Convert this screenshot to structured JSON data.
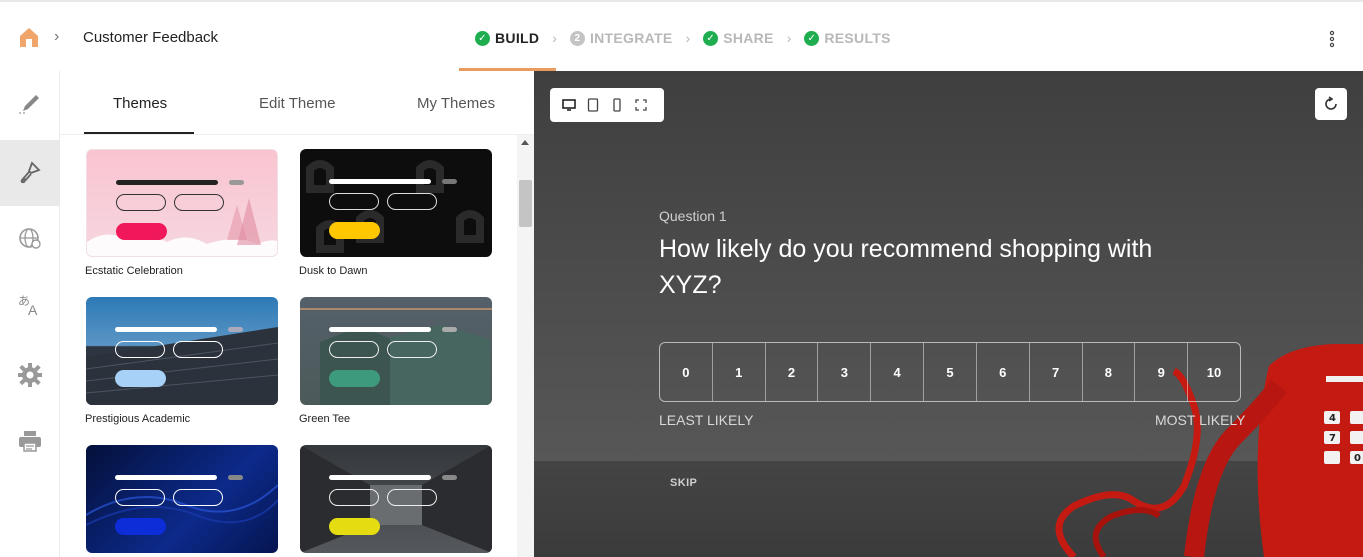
{
  "header": {
    "breadcrumb_title": "Customer Feedback",
    "steps": [
      {
        "label": "BUILD",
        "badge": "✓",
        "state": "done-active"
      },
      {
        "label": "INTEGRATE",
        "badge": "2",
        "state": "pending"
      },
      {
        "label": "SHARE",
        "badge": "✓",
        "state": "done"
      },
      {
        "label": "RESULTS",
        "badge": "✓",
        "state": "done"
      }
    ],
    "accent_color": "#e99b5d",
    "success_color": "#1fae4f"
  },
  "rail": {
    "items": [
      "edit-icon",
      "brush-icon",
      "globe-icon",
      "translate-icon",
      "gear-icon",
      "printer-icon"
    ],
    "active_index": 1
  },
  "panel": {
    "tabs": [
      {
        "label": "Themes",
        "active": true
      },
      {
        "label": "Edit Theme",
        "active": false
      },
      {
        "label": "My Themes",
        "active": false
      }
    ],
    "themes": [
      {
        "label": "Ecstatic Celebration",
        "cta_color": "#f0175a"
      },
      {
        "label": "Dusk to Dawn",
        "cta_color": "#ffc700"
      },
      {
        "label": "Prestigious Academic",
        "cta_color": "#a7d1f7"
      },
      {
        "label": "Green Tee",
        "cta_color": "#3e9a7c"
      },
      {
        "label": "",
        "cta_color": "#0d2dd8"
      },
      {
        "label": "",
        "cta_color": "#e5dc12"
      }
    ]
  },
  "preview": {
    "question_number": "Question 1",
    "question_text": "How likely do you recommend shopping with XYZ?",
    "scale": [
      "0",
      "1",
      "2",
      "3",
      "4",
      "5",
      "6",
      "7",
      "8",
      "9",
      "10"
    ],
    "least_label": "LEAST LIKELY",
    "most_label": "MOST LIKELY",
    "skip_label": "SKIP"
  }
}
